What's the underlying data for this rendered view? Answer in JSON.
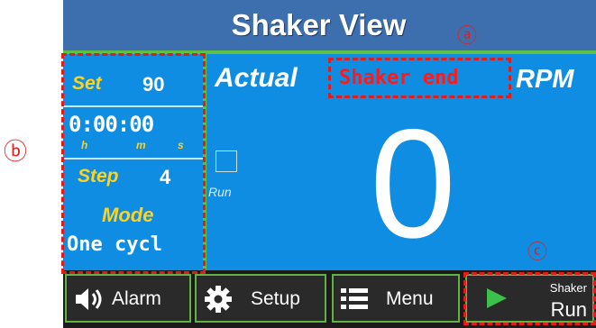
{
  "title": "Shaker View",
  "left_panel": {
    "set_label": "Set",
    "set_value": "90",
    "time_value": "0:00:00",
    "time_h": "h",
    "time_m": "m",
    "time_s": "s",
    "step_label": "Step",
    "step_value": "4",
    "mode_label": "Mode",
    "mode_value": "One cycl"
  },
  "main": {
    "actual_label": "Actual",
    "status_text": "Shaker end",
    "rpm_label": "RPM",
    "rpm_value": "0",
    "run_label": "Run"
  },
  "buttons": {
    "alarm": "Alarm",
    "setup": "Setup",
    "menu": "Menu",
    "run_top": "Shaker",
    "run_bottom": "Run"
  },
  "annotations": {
    "a": "ⓐ",
    "b": "ⓑ",
    "c": "ⓒ"
  },
  "colors": {
    "title_bg": "#3d6fae",
    "panel_bg": "#0f8de3",
    "accent_green": "#5fc046",
    "label_yellow": "#ffd21f",
    "status_red": "#ff1a1a",
    "annotation_red": "#e21b1b"
  },
  "icons": [
    "speaker-icon",
    "gear-icon",
    "list-icon",
    "play-icon"
  ]
}
